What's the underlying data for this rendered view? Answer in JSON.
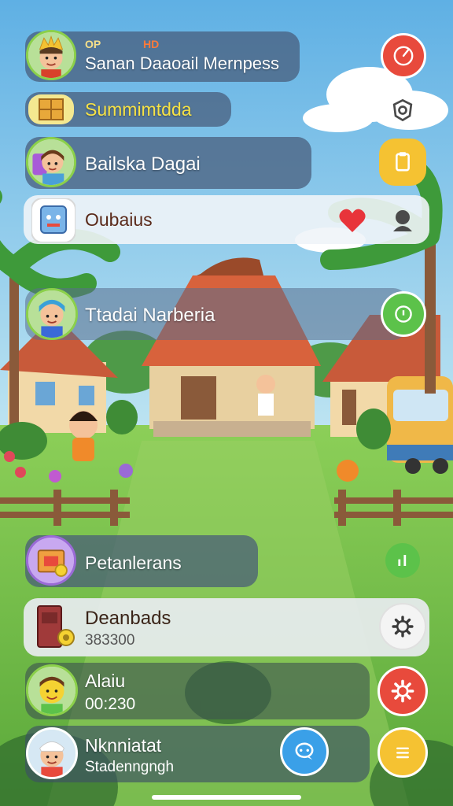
{
  "colors": {
    "sky": "#8ccbe8",
    "grass": "#7cc35a",
    "panel_dark": "#465a78",
    "panel_light": "#f0f4f8",
    "red_button": "#e84a3c",
    "yellow_button": "#f5c232",
    "green_button": "#5cc24a",
    "white_button": "#f4f4f4"
  },
  "header": {
    "tag_left": "OP",
    "tag_right": "HD",
    "title": "Sanan Daaoail Mernpess",
    "avatar_icon": "king-avatar-icon",
    "action_icon": "compass-dial-icon"
  },
  "rows": [
    {
      "id": "summit",
      "label": "Summimtdda",
      "icon": "crate-icon",
      "right_icon": "shield-outline-icon"
    },
    {
      "id": "baiska",
      "label": "Bailska Dagai",
      "avatar_icon": "girl-avatar-icon",
      "right_icon": "clipboard-icon"
    },
    {
      "id": "oubaius",
      "label": "Oubaius",
      "icon": "tablet-icon",
      "heart_icon": "heart-icon",
      "right_icon": "person-icon"
    },
    {
      "id": "ttadai",
      "label": "Ttadai Narberia",
      "avatar_icon": "boy-avatar-icon",
      "right_icon": "target-ring-icon"
    }
  ],
  "bottom": {
    "pet": {
      "label": "Petanlerans",
      "icon": "gift-box-icon",
      "right_icon": "bar-signal-icon"
    },
    "dean": {
      "label": "Deanbads",
      "value": "383300",
      "icon": "door-coin-icon",
      "right_icon": "gear-outline-icon"
    },
    "alaiu": {
      "label": "Alaiu",
      "value": "00:230",
      "avatar_icon": "smiling-boy-avatar-icon",
      "right_icon": "red-gear-icon"
    },
    "nkn": {
      "label": "Nknniatat",
      "value": "Stadenngngh",
      "avatar_icon": "chef-girl-avatar-icon",
      "chat_icon": "chat-bubble-icon",
      "right_icon": "menu-icon"
    }
  }
}
